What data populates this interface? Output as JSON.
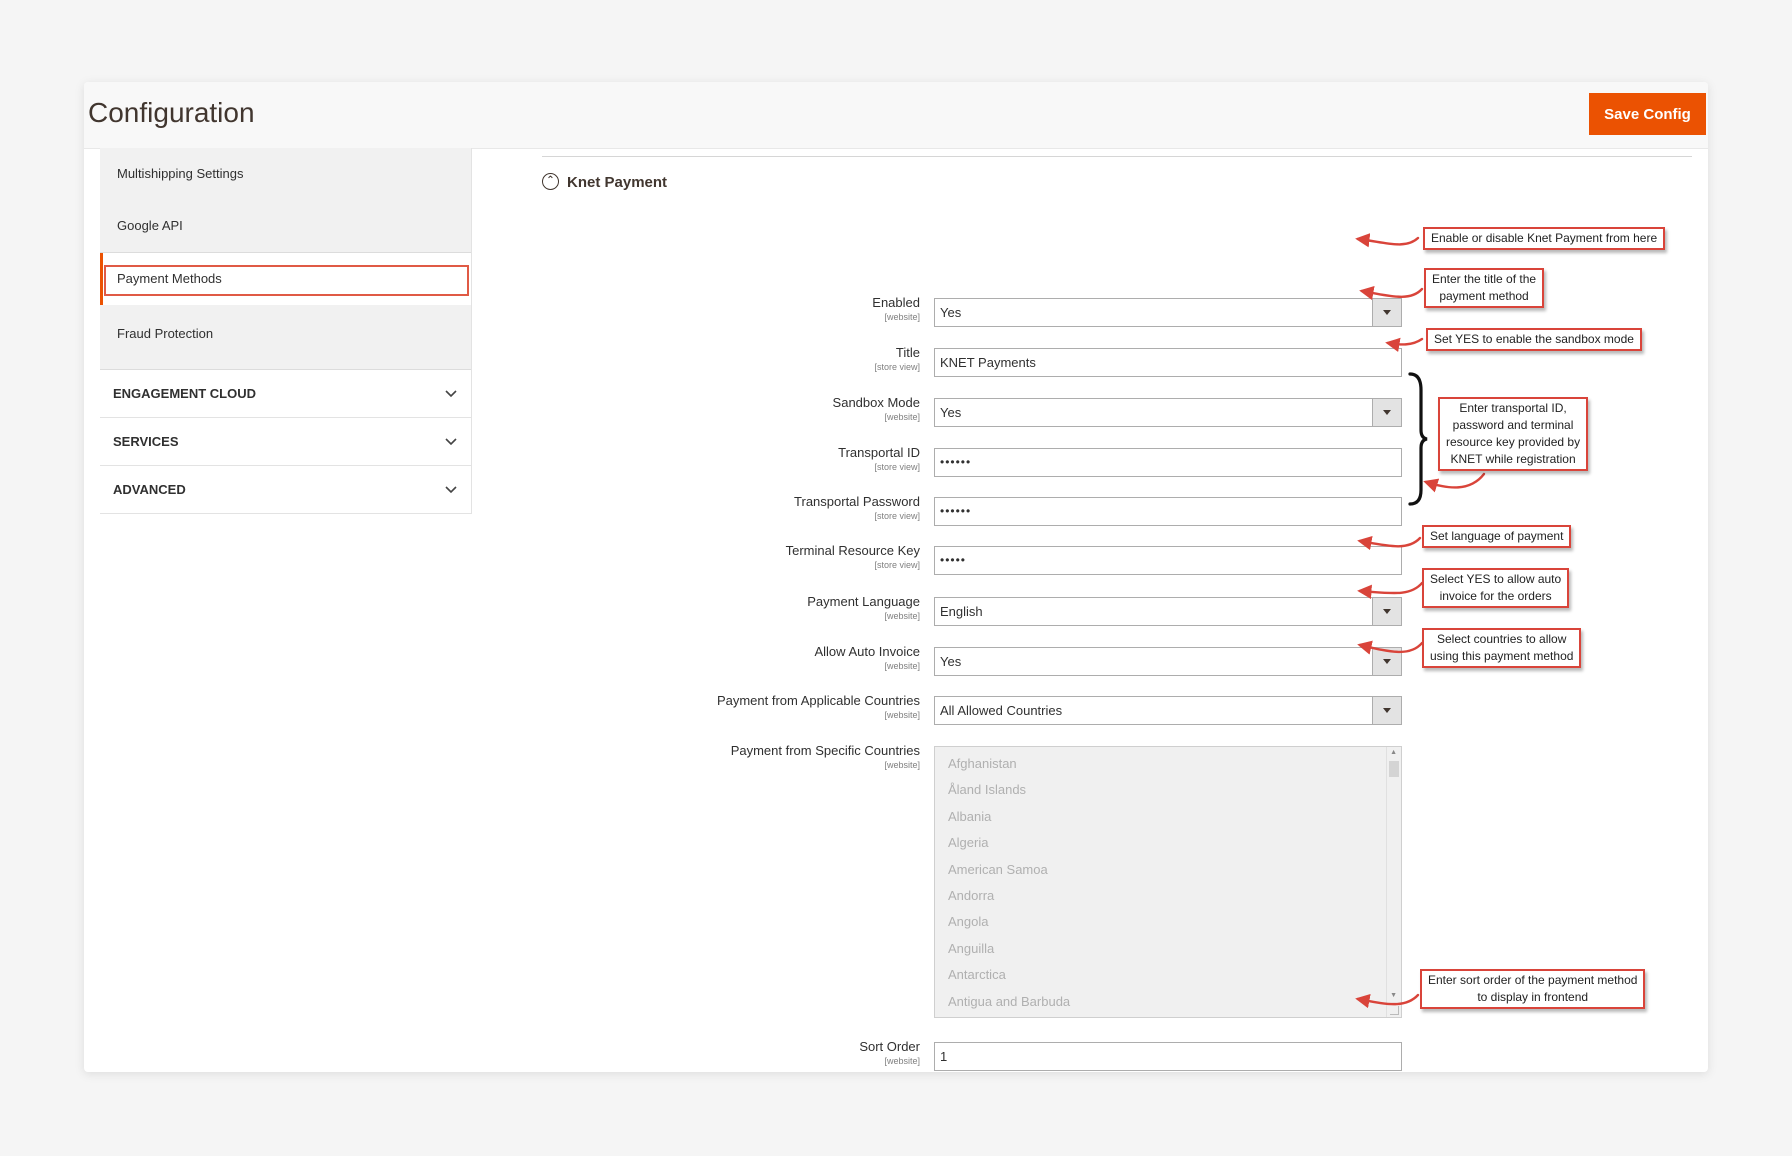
{
  "header": {
    "title": "Configuration",
    "save_label": "Save Config",
    "accent_color": "#eb5202"
  },
  "sidebar": {
    "sub_items": [
      {
        "label": "Multishipping Settings"
      },
      {
        "label": "Google API"
      },
      {
        "label": "Payment Methods",
        "active": true
      },
      {
        "label": "Fraud Protection"
      }
    ],
    "sections": [
      {
        "label": "ENGAGEMENT CLOUD",
        "icon": "chevron-down-icon"
      },
      {
        "label": "SERVICES",
        "icon": "chevron-down-icon"
      },
      {
        "label": "ADVANCED",
        "icon": "chevron-down-icon"
      }
    ]
  },
  "main": {
    "section_title": "Knet Payment",
    "fields": [
      {
        "label": "Enabled",
        "scope": "[website]",
        "value": "Yes",
        "type": "select"
      },
      {
        "label": "Title",
        "scope": "[store view]",
        "value": "KNET Payments",
        "type": "text"
      },
      {
        "label": "Sandbox Mode",
        "scope": "[website]",
        "value": "Yes",
        "type": "select"
      },
      {
        "label": "Transportal ID",
        "scope": "[store view]",
        "value": "••••••",
        "type": "password"
      },
      {
        "label": "Transportal Password",
        "scope": "[store view]",
        "value": "••••••",
        "type": "password"
      },
      {
        "label": "Terminal Resource Key",
        "scope": "[store view]",
        "value": "•••••",
        "type": "password"
      },
      {
        "label": "Payment Language",
        "scope": "[website]",
        "value": "English",
        "type": "select"
      },
      {
        "label": "Allow Auto Invoice",
        "scope": "[website]",
        "value": "Yes",
        "type": "select"
      },
      {
        "label": "Payment from Applicable Countries",
        "scope": "[website]",
        "value": "All Allowed Countries",
        "type": "select"
      },
      {
        "label": "Payment from Specific Countries",
        "scope": "[website]",
        "type": "multiselect",
        "options": [
          "Afghanistan",
          "Åland Islands",
          "Albania",
          "Algeria",
          "American Samoa",
          "Andorra",
          "Angola",
          "Anguilla",
          "Antarctica",
          "Antigua and Barbuda"
        ]
      },
      {
        "label": "Sort Order",
        "scope": "[website]",
        "value": "1",
        "type": "text"
      }
    ]
  },
  "annotations": {
    "color": "#d9443a",
    "notes": [
      {
        "lines": [
          "Enable or disable Knet Payment from here"
        ]
      },
      {
        "lines": [
          "Enter the title of the",
          "payment method"
        ]
      },
      {
        "lines": [
          "Set YES to enable the sandbox mode"
        ]
      },
      {
        "lines": [
          "Enter transportal ID,",
          "password and terminal",
          "resource key provided by",
          "KNET while registration"
        ]
      },
      {
        "lines": [
          "Set language of payment"
        ]
      },
      {
        "lines": [
          "Select YES to allow auto",
          "invoice for the orders"
        ]
      },
      {
        "lines": [
          "Select countries to allow",
          "using this payment method"
        ]
      },
      {
        "lines": [
          "Enter sort order of the payment method",
          "to display in frontend"
        ]
      }
    ]
  }
}
